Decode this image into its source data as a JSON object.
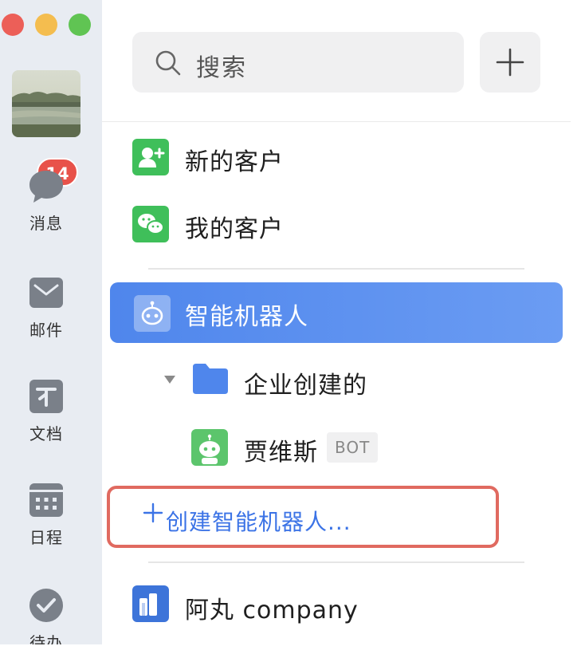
{
  "window": {
    "traffic_lights": [
      "close",
      "minimize",
      "zoom"
    ]
  },
  "rail": {
    "badge_count": "14",
    "items": [
      {
        "label": "消息",
        "icon": "chat-bubble-icon"
      },
      {
        "label": "邮件",
        "icon": "mail-icon"
      },
      {
        "label": "文档",
        "icon": "document-icon"
      },
      {
        "label": "日程",
        "icon": "calendar-icon"
      },
      {
        "label": "待办",
        "icon": "checkmark-icon"
      }
    ]
  },
  "search": {
    "placeholder": "搜索"
  },
  "list": {
    "new_customers": "新的客户",
    "my_customers": "我的客户",
    "smart_robot": "智能机器人",
    "folder": "企业创建的",
    "bot_name": "贾维斯",
    "bot_tag": "BOT",
    "create_robot": "创建智能机器人...",
    "company": "阿丸 company"
  },
  "colors": {
    "accent": "#4f86ec",
    "green": "#3fbf5a",
    "badge": "#e8524a",
    "highlight_border": "#e06a60",
    "link": "#3b73e6"
  }
}
